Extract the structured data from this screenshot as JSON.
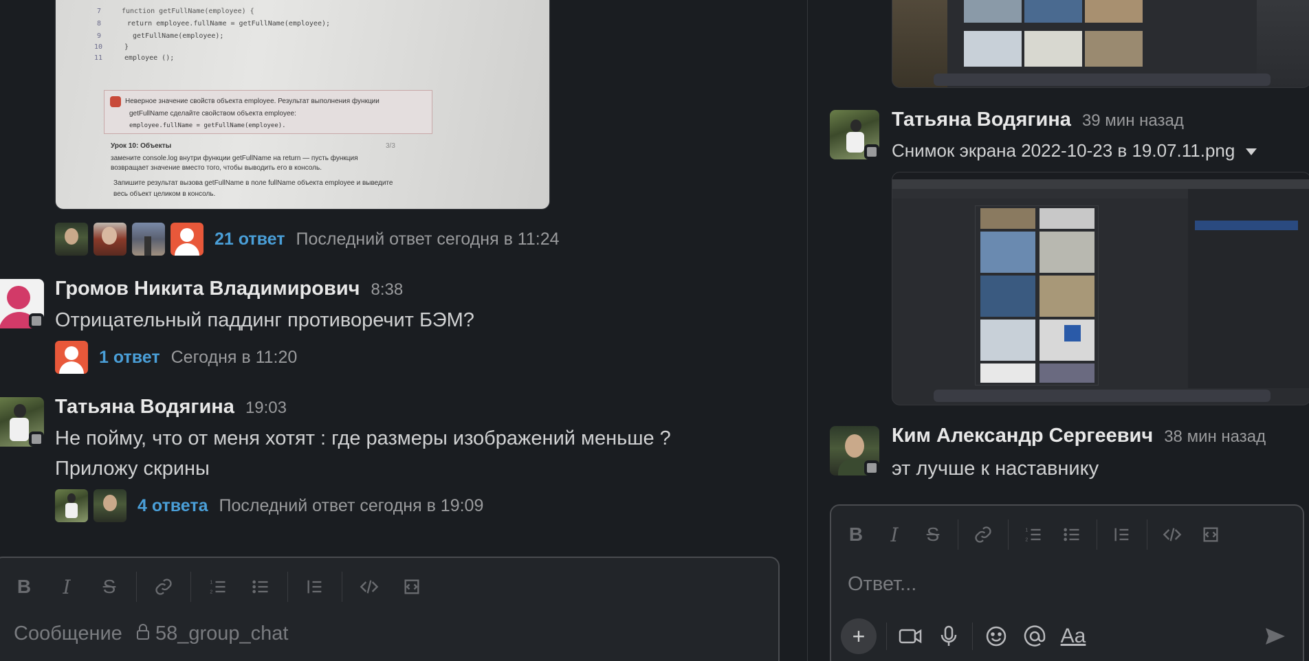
{
  "messages": [
    {
      "replies": {
        "count": "21 ответ",
        "meta": "Последний ответ сегодня в 11:24"
      }
    },
    {
      "author": "Громов Никита Владимирович",
      "time": "8:38",
      "text": "Отрицательный паддинг противоречит БЭМ?",
      "replies": {
        "count": "1 ответ",
        "meta": "Сегодня в 11:20"
      }
    },
    {
      "author": "Татьяна Водягина",
      "time": "19:03",
      "text_line1": "Не пойму, что от меня хотят : где размеры изображений меньше ?",
      "text_line2": "Приложу скрины",
      "replies": {
        "count": "4 ответа",
        "meta": "Последний ответ сегодня в 19:09"
      }
    }
  ],
  "screenshot_text": {
    "line1": "Неверное значение свойств объекта employee. Результат выполнения функции",
    "line2": "getFullName сделайте свойством объекта employee:",
    "line3": "employee.fullName = getFullName(employee).",
    "lesson": "Урок 10: Объекты",
    "pager": "3/3",
    "task1": "замените console.log внутри функции getFullName на return — пусть функция",
    "task2": "возвращает значение вместо того, чтобы выводить его в консоль.",
    "task3": "Запишите результат вызова getFullName в поле fullName объекта employee и выведите",
    "task4": "весь объект целиком в консоль.",
    "code1": "function getFullName(employee) {",
    "code2": "return employee.fullName = getFullName(employee);",
    "code3": "getFullName(employee);",
    "code4": "}",
    "code5": "employee ();",
    "ln7": "7",
    "ln8": "8",
    "ln9": "9",
    "ln10": "10",
    "ln11": "11"
  },
  "main_composer": {
    "placeholder": "Сообщение",
    "channel": "58_group_chat"
  },
  "thread": {
    "messages": [
      {
        "author": "Татьяна Водягина",
        "time": "39 мин назад",
        "file": "Снимок экрана 2022-10-23 в 19.07.11.png"
      },
      {
        "author": "Ким Александр Сергеевич",
        "time": "38 мин назад",
        "text": "эт лучше к наставнику"
      }
    ],
    "composer": {
      "placeholder": "Ответ..."
    }
  },
  "icons": {
    "bold": "B",
    "italic": "I",
    "strike": "S",
    "aa": "Aa"
  },
  "colors": {
    "background": "#1a1d21",
    "link": "#4a9fd8",
    "muted": "#9a9b9d"
  }
}
